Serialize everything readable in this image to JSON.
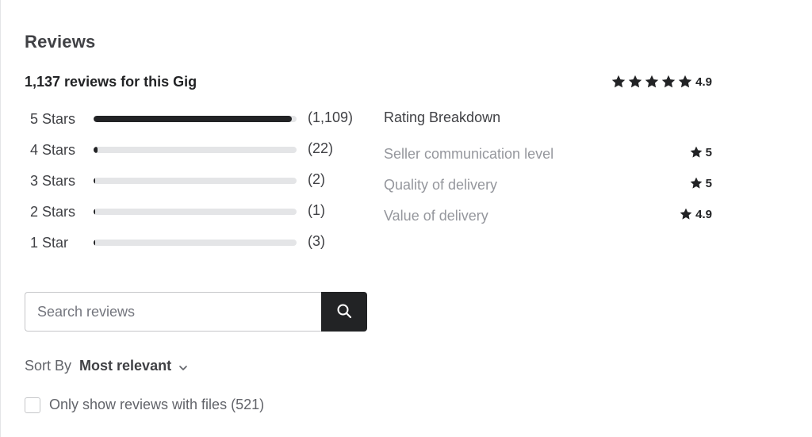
{
  "reviews": {
    "heading": "Reviews",
    "summary": "1,137 reviews for this Gig",
    "overall_rating": "4.9",
    "overall_stars": 5,
    "star_breakdown": [
      {
        "label": "5 Stars",
        "count": "(1,109)",
        "fraction": 0.975
      },
      {
        "label": "4 Stars",
        "count": "(22)",
        "fraction": 0.019
      },
      {
        "label": "3 Stars",
        "count": "(2)",
        "fraction": 0.002
      },
      {
        "label": "2 Stars",
        "count": "(1)",
        "fraction": 0.001
      },
      {
        "label": "1 Star",
        "count": "(3)",
        "fraction": 0.003
      }
    ],
    "rating_breakdown": {
      "title": "Rating Breakdown",
      "items": [
        {
          "label": "Seller communication level",
          "value": "5"
        },
        {
          "label": "Quality of delivery",
          "value": "5"
        },
        {
          "label": "Value of delivery",
          "value": "4.9"
        }
      ]
    },
    "search": {
      "placeholder": "Search reviews",
      "icon": "search-icon"
    },
    "sort": {
      "label": "Sort By",
      "value": "Most relevant",
      "icon": "chevron-down-icon"
    },
    "files_filter": {
      "label": "Only show reviews with files (521)",
      "checked": false
    }
  },
  "colors": {
    "text_dark": "#222325",
    "text_body": "#404145",
    "text_muted": "#95979d",
    "bar_track": "#e4e5e7",
    "bar_fill": "#222325",
    "button_bg": "#222325"
  }
}
